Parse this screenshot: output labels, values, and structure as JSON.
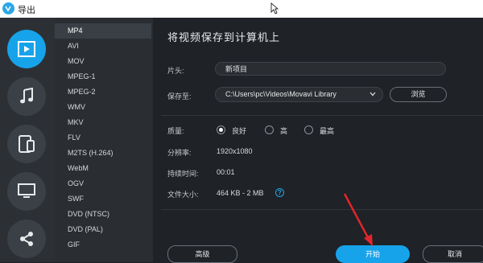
{
  "window": {
    "title": "导出"
  },
  "sidebar": {
    "icons": [
      {
        "name": "video-icon",
        "active": true
      },
      {
        "name": "music-note-icon",
        "active": false
      },
      {
        "name": "devices-icon",
        "active": false
      },
      {
        "name": "monitor-icon",
        "active": false
      },
      {
        "name": "share-icon",
        "active": false
      }
    ]
  },
  "formats": [
    "MP4",
    "AVI",
    "MOV",
    "MPEG-1",
    "MPEG-2",
    "WMV",
    "MKV",
    "FLV",
    "M2TS (H.264)",
    "WebM",
    "OGV",
    "SWF",
    "DVD (NTSC)",
    "DVD (PAL)",
    "GIF"
  ],
  "main": {
    "heading": "将视频保存到计算机上",
    "name_label": "片头:",
    "name_value": "新项目",
    "save_label": "保存至:",
    "save_path": "C:\\Users\\pc\\Videos\\Movavi Library",
    "browse_label": "浏览",
    "quality_label": "质量:",
    "quality_options": [
      {
        "label": "良好",
        "selected": true
      },
      {
        "label": "高",
        "selected": false
      },
      {
        "label": "最高",
        "selected": false
      }
    ],
    "resolution_label": "分辨率:",
    "resolution_value": "1920x1080",
    "duration_label": "持续时间:",
    "duration_value": "00:01",
    "filesize_label": "文件大小:",
    "filesize_value": "464 KB - 2 MB",
    "help_symbol": "?",
    "advanced_label": "高级",
    "start_label": "开始",
    "cancel_label": "取消"
  },
  "colors": {
    "accent": "#17a3ea",
    "annotation_arrow": "#e0262c"
  }
}
